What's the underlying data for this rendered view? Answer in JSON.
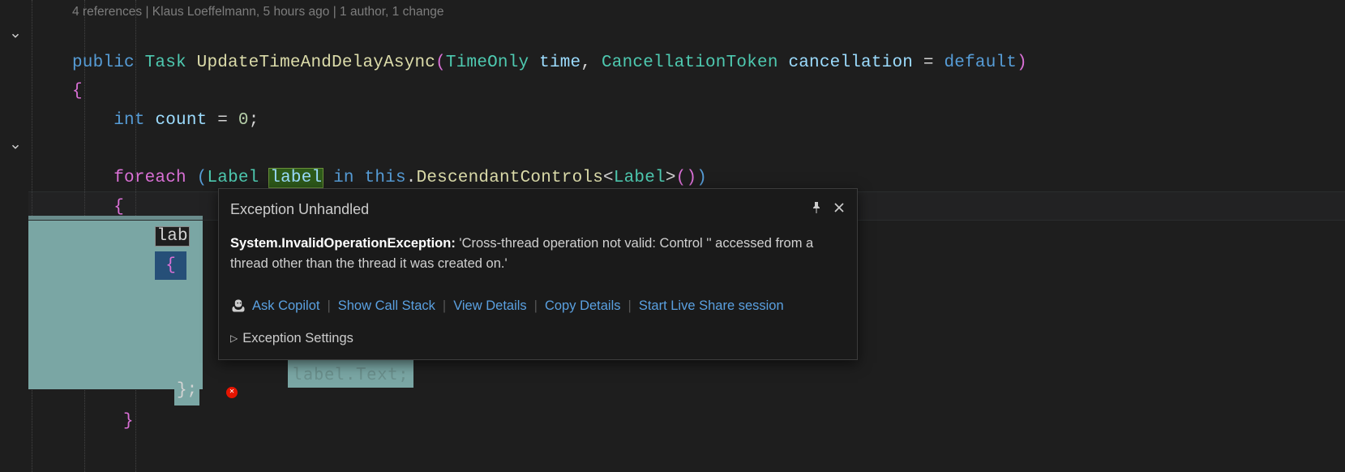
{
  "codelens": "4 references | Klaus Loeffelmann, 5 hours ago | 1 author, 1 change",
  "code": {
    "public": "public",
    "task": "Task",
    "methodName": "UpdateTimeAndDelayAsync",
    "timeOnly": "TimeOnly",
    "timeParam": "time",
    "cancelType": "CancellationToken",
    "cancelParam": "cancellation",
    "eq": "=",
    "defaultKw": "default",
    "openParen": "(",
    "closeParen": ")",
    "comma": ", ",
    "openBrace": "{",
    "closeBrace": "}",
    "intKw": "int",
    "countVar": "count",
    "zero": "0",
    "semi": ";",
    "foreachKw": "foreach",
    "labelType": "Label",
    "labelVar": "label",
    "inKw": "in",
    "thisKw": "this",
    "dot": ".",
    "descMethod": "DescendantControls",
    "lt": "<",
    "gt": ">",
    "parens": "()",
    "labFrag": "lab",
    "innerOpenBrace": "{",
    "closingSymbol": "};",
    "obscured": "label.Text;"
  },
  "popup": {
    "title": "Exception Unhandled",
    "excType": "System.InvalidOperationException:",
    "msg": " 'Cross-thread operation not valid: Control '' accessed from a thread other than the thread it was created on.'",
    "links": {
      "copilot": "Ask Copilot",
      "stack": "Show Call Stack",
      "details": "View Details",
      "copy": "Copy Details",
      "liveshare": "Start Live Share session"
    },
    "settings": "Exception Settings"
  }
}
